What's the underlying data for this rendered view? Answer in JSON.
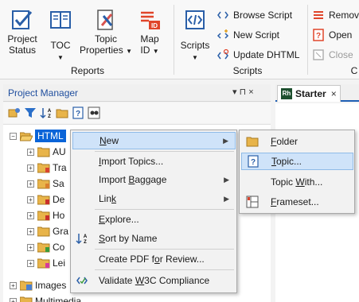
{
  "ribbon": {
    "reports": {
      "group_label": "Reports",
      "project_status": [
        "Project",
        "Status"
      ],
      "toc": "TOC",
      "topic_properties": [
        "Topic",
        "Properties"
      ],
      "map_id": [
        "Map",
        "ID"
      ]
    },
    "scripts": {
      "group_label": "Scripts",
      "scripts_button": "Scripts",
      "browse_script": "Browse Script",
      "new_script": "New Script",
      "update_dhtml": "Update DHTML"
    },
    "right_group": {
      "remove": "Remove",
      "open": "Open",
      "close": "Close"
    },
    "partial_group_label": "C"
  },
  "project_manager": {
    "title": "Project Manager",
    "pin_glyph": "▾ ⊓ ×"
  },
  "tree": {
    "root": "HTML",
    "children": [
      "AU",
      "Tra",
      "Sa",
      "De",
      "Ho",
      "Gra",
      "Co",
      "Lei"
    ],
    "images": "Images",
    "multimedia": "Multimedia"
  },
  "document_tab": {
    "badge": "Rh",
    "title": "Starter",
    "close": "×"
  },
  "context_menu": {
    "items": [
      {
        "prefix": "",
        "u": "N",
        "suffix": "ew",
        "has_submenu": true
      },
      {
        "prefix": "",
        "u": "I",
        "suffix": "mport Topics...",
        "has_submenu": false
      },
      {
        "prefix": "Import ",
        "u": "B",
        "suffix": "aggage",
        "has_submenu": true
      },
      {
        "prefix": "Lin",
        "u": "k",
        "suffix": "",
        "has_submenu": true
      },
      {
        "prefix": "",
        "u": "E",
        "suffix": "xplore...",
        "has_submenu": false
      },
      {
        "prefix": "",
        "u": "S",
        "suffix": "ort by Name",
        "has_submenu": false
      },
      {
        "prefix": "Create PDF f",
        "u": "o",
        "suffix": "r Review...",
        "has_submenu": false
      },
      {
        "prefix": "Validate ",
        "u": "W",
        "suffix": "3C Compliance",
        "has_submenu": false
      }
    ]
  },
  "submenu": {
    "items": [
      {
        "prefix": "",
        "u": "F",
        "suffix": "older"
      },
      {
        "prefix": "",
        "u": "T",
        "suffix": "opic..."
      },
      {
        "prefix": "Topic ",
        "u": "W",
        "suffix": "ith..."
      },
      {
        "prefix": "",
        "u": "F",
        "suffix": "rameset..."
      }
    ]
  },
  "colors": {
    "accent_blue": "#1f4e9e",
    "selection": "#0a64d8",
    "menu_highlight": "#cfe3f9",
    "robohelp_red": "#e0452a"
  }
}
